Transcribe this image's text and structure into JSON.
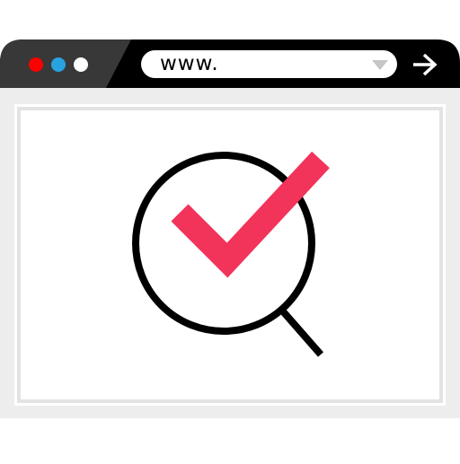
{
  "window": {
    "dots": {
      "close_color": "#ff0000",
      "minimize_color": "#29a3e0",
      "maximize_color": "#ffffff"
    },
    "address_bar": {
      "value": "www."
    },
    "go_button_icon": "arrow-right-icon",
    "dropdown_icon": "triangle-down-icon"
  },
  "content": {
    "illustration": {
      "magnifier_icon": "magnifying-glass-icon",
      "check_icon": "checkmark-icon",
      "check_color": "#f2335a",
      "magnifier_color": "#000000"
    }
  }
}
